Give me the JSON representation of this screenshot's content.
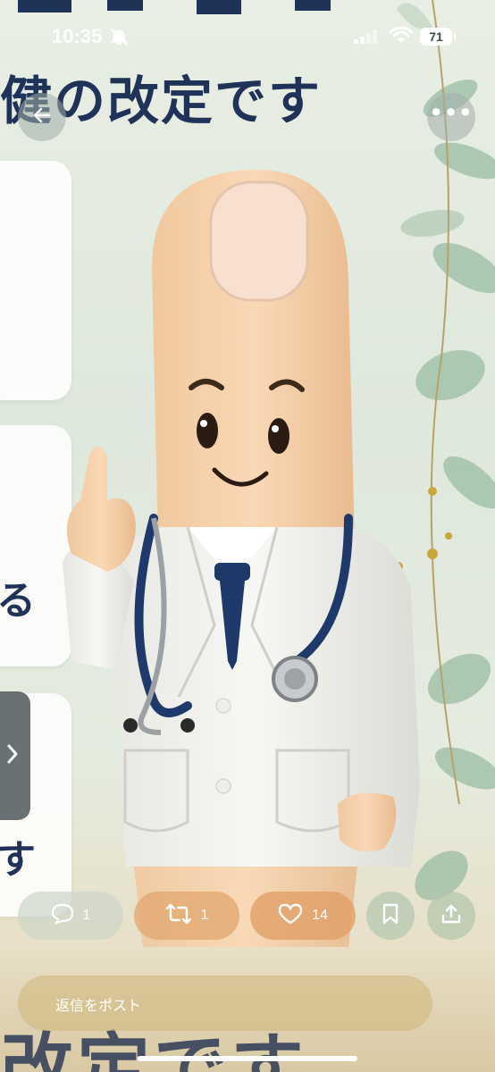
{
  "status_bar": {
    "time": "10:35",
    "battery": "71",
    "icons": [
      "bell-slash-icon",
      "signal-icon",
      "wifi-icon",
      "battery-icon"
    ]
  },
  "image": {
    "heading_text": "健の改定です",
    "side_card_chars": [
      "る",
      "す"
    ],
    "bottom_text": "改定です"
  },
  "actions": {
    "reply_count": "1",
    "repost_count": "1",
    "like_count": "14"
  },
  "reply_bar": {
    "placeholder": "返信をポスト"
  },
  "colors": {
    "heading": "#1f3358",
    "like_pill": "#e2a068",
    "background": "#e4ecdf"
  }
}
